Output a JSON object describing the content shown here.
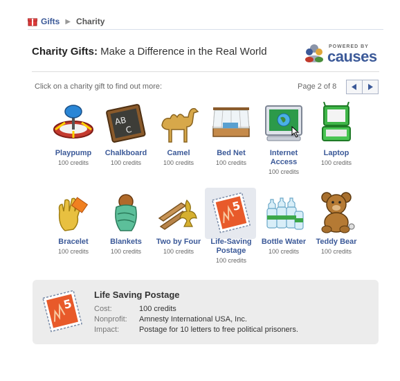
{
  "breadcrumb": {
    "root": "Gifts",
    "current": "Charity"
  },
  "header": {
    "title_bold": "Charity Gifts:",
    "title_rest": " Make a Difference in the Real World"
  },
  "powered": {
    "label": "POWERED BY",
    "brand": "causes"
  },
  "instructions": "Click on a charity gift to find out more:",
  "pager": {
    "text": "Page 2 of 8"
  },
  "gifts": [
    {
      "name": "Playpump",
      "credits": "100 credits",
      "icon": "playpump-icon"
    },
    {
      "name": "Chalkboard",
      "credits": "100 credits",
      "icon": "chalkboard-icon"
    },
    {
      "name": "Camel",
      "credits": "100 credits",
      "icon": "camel-icon"
    },
    {
      "name": "Bed Net",
      "credits": "100 credits",
      "icon": "bed-net-icon"
    },
    {
      "name": "Internet Access",
      "credits": "100 credits",
      "icon": "computer-icon"
    },
    {
      "name": "Laptop",
      "credits": "100 credits",
      "icon": "laptop-icon"
    },
    {
      "name": "Bracelet",
      "credits": "100 credits",
      "icon": "bracelet-icon"
    },
    {
      "name": "Blankets",
      "credits": "100 credits",
      "icon": "blankets-icon"
    },
    {
      "name": "Two by Four",
      "credits": "100 credits",
      "icon": "lumber-icon"
    },
    {
      "name": "Life-Saving Postage",
      "credits": "100 credits",
      "icon": "stamp-icon",
      "selected": true
    },
    {
      "name": "Bottle Water",
      "credits": "100 credits",
      "icon": "water-bottles-icon"
    },
    {
      "name": "Teddy Bear",
      "credits": "100 credits",
      "icon": "teddy-bear-icon"
    }
  ],
  "detail": {
    "title": "Life Saving Postage",
    "cost_label": "Cost:",
    "cost": "100 credits",
    "nonprofit_label": "Nonprofit:",
    "nonprofit": "Amnesty International USA, Inc.",
    "impact_label": "Impact:",
    "impact": "Postage for 10 letters to free political prisoners."
  }
}
